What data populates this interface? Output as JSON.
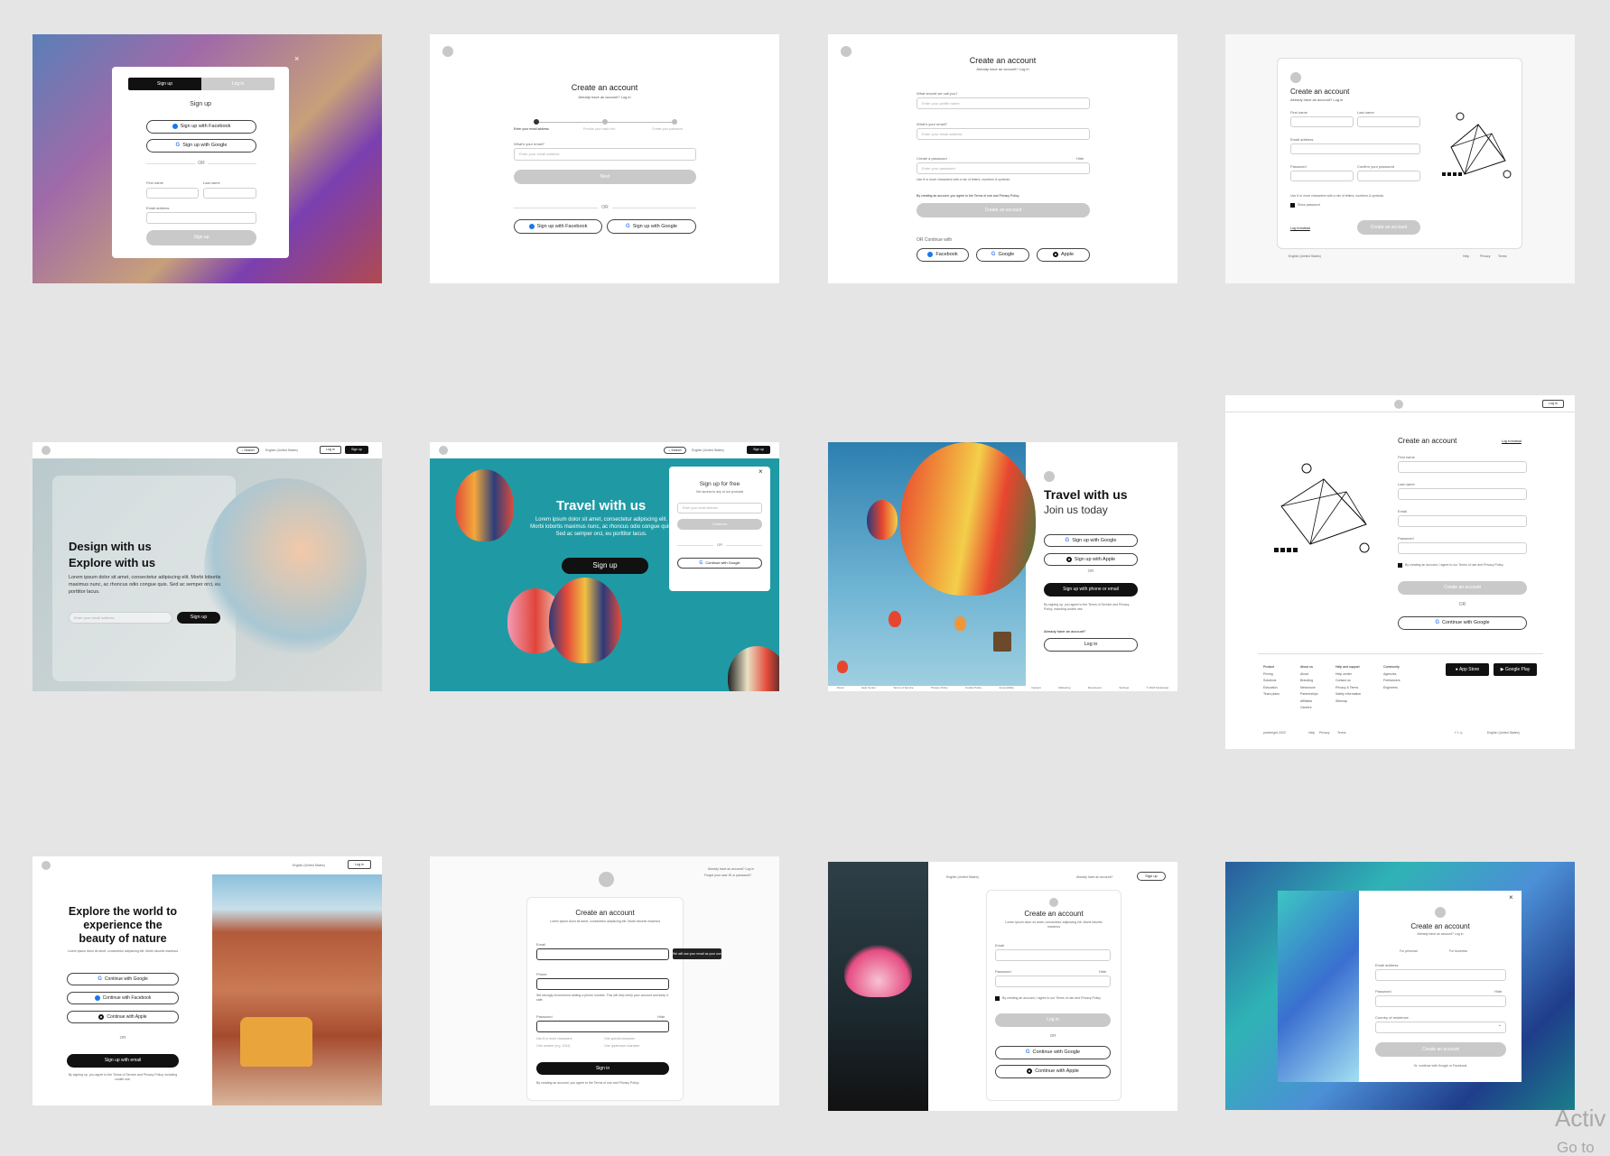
{
  "card1": {
    "tabs": [
      "Sign up",
      "Log in"
    ],
    "title": "Sign up",
    "facebook": "Sign up with Facebook",
    "google": "Sign up with Google",
    "or": "OR",
    "first_name": "First name",
    "last_name": "Last name",
    "email": "Email address",
    "submit": "Sign up"
  },
  "card2": {
    "title": "Create an account",
    "subtitle": "Already have an account? Log in",
    "steps": [
      "Enter your email address",
      "Provide your basic info",
      "Create your password"
    ],
    "email_label": "What's your email?",
    "email_placeholder": "Enter your email address",
    "next": "Next",
    "or": "OR",
    "facebook": "Sign up with Facebook",
    "google": "Sign up with Google"
  },
  "card3": {
    "title": "Create an account",
    "subtitle": "Already have an account? Log in",
    "name_label": "What should we call you?",
    "name_placeholder": "Enter your profile name",
    "email_label": "What's your email?",
    "email_placeholder": "Enter your email address",
    "password_label": "Create a password",
    "hide": "Hide",
    "password_placeholder": "Enter your password",
    "hint": "Use 8 or more characters with a mix of letters, numbers & symbols",
    "terms": "By creating an account, you agree to the Terms of use and Privacy Policy.",
    "submit": "Create an account",
    "continue": "OR Continue with",
    "facebook": "Facebook",
    "google": "Google",
    "apple": "Apple"
  },
  "card4": {
    "title": "Create an account",
    "subtitle": "Already have an account? Log in",
    "first_name": "First name",
    "last_name": "Last name",
    "email": "Email address",
    "password": "Password",
    "confirm": "Confirm your password",
    "hint": "Use 8 or more characters with a mix of letters, numbers & symbols",
    "show": "Show password",
    "login_instead": "Log in instead",
    "submit": "Create an account",
    "lang": "English (United States)",
    "footer": [
      "Help",
      "Privacy",
      "Terms"
    ]
  },
  "card5": {
    "search": "Search",
    "lang": "English (United States)",
    "login": "Log in",
    "signup": "Sign up",
    "headline1": "Design with us",
    "headline2": "Explore with us",
    "body": "Lorem ipsum dolor sit amet, consectetur adipiscing elit. Morbi lobortis maximus nunc, ac rhoncus odio congue quis. Sed ac semper orci, eu porttitor lacus.",
    "email_placeholder": "Enter your email address",
    "cta": "Sign up"
  },
  "card6": {
    "search": "Search",
    "lang": "English (United States)",
    "signup": "Sign up",
    "headline": "Travel with us",
    "body": "Lorem ipsum dolor sit amet, consectetur adipiscing elit. Morbi lobortis maximus nunc, ac rhoncus odio congue quis. Sed ac semper orci, eu porttitor lacus.",
    "cta": "Sign up",
    "panel_title": "Sign up for free",
    "panel_sub": "Get access to any of our products",
    "email_placeholder": "Enter your email address",
    "continue": "Continue",
    "or": "OR",
    "google": "Continue with Google"
  },
  "card7": {
    "title": "Travel with us",
    "subtitle": "Join us today",
    "google": "Sign up with Google",
    "apple": "Sign up with Apple",
    "or": "OR",
    "phone": "Sign up with phone or email",
    "terms": "By signing up, you agree to the Terms of Service and Privacy Policy, including cookie use.",
    "have": "Already have an account?",
    "login": "Log in",
    "footer": [
      "About",
      "Help Center",
      "Terms of Service",
      "Privacy Policy",
      "Cookie Policy",
      "Accessibility",
      "Careers",
      "Marketing",
      "Developers",
      "Settings",
      "© 2023 Sandesign"
    ]
  },
  "card8": {
    "login_top": "Log in",
    "title": "Create an account",
    "login_instead": "Log in instead",
    "first": "First name",
    "last": "Last name",
    "email": "Email",
    "password": "Password",
    "agree": "By creating an account, I agree to our Terms of use and Privacy Policy",
    "submit": "Create an account",
    "or": "OR",
    "google": "Continue with Google",
    "cols": [
      {
        "h": "Product",
        "items": [
          "Pricing",
          "Solutions",
          "Education",
          "Team plans"
        ]
      },
      {
        "h": "About us",
        "items": [
          "About",
          "Branding",
          "Newsroom",
          "Partnerships",
          "Affiliates",
          "Careers"
        ]
      },
      {
        "h": "Help and support",
        "items": [
          "Help center",
          "Contact us",
          "Privacy & Terms",
          "Safety information",
          "Sitemap"
        ]
      },
      {
        "h": "Community",
        "items": [
          "Agencies",
          "Freelancers",
          "Engineers"
        ]
      }
    ],
    "appstore": "App Store",
    "gplay": "Google Play",
    "copyright": "pixelbright 2023",
    "legal": [
      "Help",
      "Privacy",
      "Terms"
    ],
    "lang": "English (United States)"
  },
  "card9": {
    "lang": "English (United States)",
    "login": "Log in",
    "headline": "Explore the world to experience the beauty of nature",
    "body": "Lorem ipsum dolor sit amet, consectetur adipiscing elit. Morbi lobortis maximus",
    "google": "Continue with Google",
    "facebook": "Continue with Facebook",
    "apple": "Continue with Apple",
    "or": "OR",
    "email": "Sign up with email",
    "terms": "By signing up, you agree to the Terms of Service and Privacy Policy, including cookie use."
  },
  "card10": {
    "top1": "Already have an account? Log in",
    "top2": "Forget your user ID or password?",
    "title": "Create an account",
    "sub": "Lorem ipsum dolor sit amet, consectetur adipiscing elit. Morbi lobortis maximus",
    "email": "Email",
    "tooltip": "We will use your email as your user ID",
    "phone": "Phone",
    "phone_hint": "We strongly recommend adding a phone number. This will help verify your account and keep it safe.",
    "password": "Password",
    "hide": "Hide",
    "rules": [
      "Use 8 or more characters",
      "One special character",
      "One number (e.g. 1234)",
      "One uppercase character"
    ],
    "submit": "Sign in",
    "terms": "By creating an account, you agree to the Terms of use and Privacy Policy."
  },
  "card11": {
    "lang": "English (United States)",
    "have": "Already have an account?",
    "signup": "Sign up",
    "title": "Create an account",
    "sub": "Lorem ipsum dolor sit amet, consectetur adipiscing elit. Morbi lobortis maximus",
    "email": "Email",
    "password": "Password",
    "hide": "Hide",
    "agree": "By creating an account, I agree to our Terms of use and Privacy Policy",
    "login": "Log in",
    "or": "OR",
    "google": "Continue with Google",
    "apple": "Continue with Apple"
  },
  "card12": {
    "title": "Create an account",
    "subtitle": "Already have an account? Log in",
    "personal": "For personal",
    "business": "For business",
    "email": "Email address",
    "password": "Password",
    "hide": "Hide",
    "country": "Country of residence",
    "submit": "Create an account",
    "continue": "Or, continue with Google or Facebook"
  },
  "watermark": {
    "line1": "Activ",
    "line2": "Go to"
  }
}
